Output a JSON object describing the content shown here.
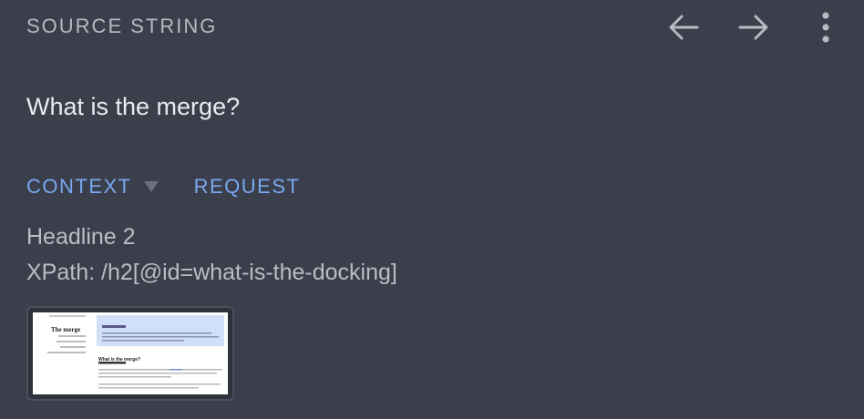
{
  "header": {
    "title": "SOURCE STRING",
    "icons": [
      "arrow-left-icon",
      "arrow-right-icon",
      "more-vertical-icon"
    ]
  },
  "source": {
    "text": "What is the merge?"
  },
  "tabs": [
    {
      "label": "CONTEXT",
      "active": true
    },
    {
      "label": "REQUEST",
      "active": false
    }
  ],
  "context": {
    "element_type": "Headline 2",
    "xpath": "XPath: /h2[@id=what-is-the-docking]"
  },
  "screenshot": {
    "page_title": "The merge",
    "hero_heading": "What is the merge?"
  },
  "colors": {
    "background": "#3a3f4b",
    "accent": "#7aa8f0",
    "text": "#c9ccd3"
  }
}
